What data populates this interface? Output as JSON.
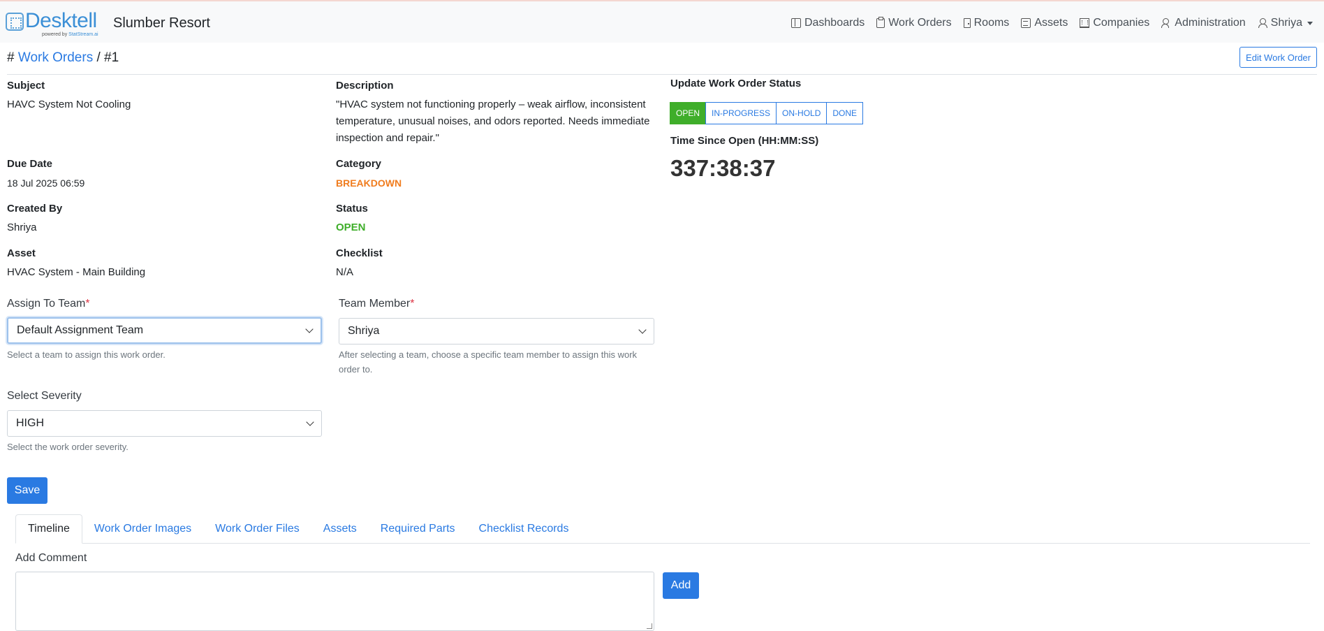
{
  "header": {
    "logo_text": "Desktell",
    "logo_sub_prefix": "powered by",
    "logo_sub_brand": "StatStream.ai",
    "org_name": "Slumber Resort"
  },
  "nav": {
    "items": [
      {
        "label": "Dashboards",
        "icon": "dashboard-icon"
      },
      {
        "label": "Work Orders",
        "icon": "clipboard-icon"
      },
      {
        "label": "Rooms",
        "icon": "door-icon"
      },
      {
        "label": "Assets",
        "icon": "asset-icon"
      },
      {
        "label": "Companies",
        "icon": "building-icon"
      },
      {
        "label": "Administration",
        "icon": "user-gear-icon"
      }
    ],
    "user": {
      "label": "Shriya",
      "icon": "user-icon"
    }
  },
  "breadcrumb": {
    "hash": "#",
    "link": "Work Orders",
    "sep": "/",
    "current": "#1"
  },
  "edit_button": "Edit Work Order",
  "details": {
    "subject": {
      "label": "Subject",
      "value": "HAVC System Not Cooling"
    },
    "description": {
      "label": "Description",
      "value": "\"HVAC system not functioning properly – weak airflow, inconsistent temperature, unusual noises, and odors reported. Needs immediate inspection and repair.\""
    },
    "due_date": {
      "label": "Due Date",
      "value": "18 Jul 2025 06:59"
    },
    "category": {
      "label": "Category",
      "value": "BREAKDOWN",
      "color": "#f07c1e"
    },
    "created_by": {
      "label": "Created By",
      "value": "Shriya"
    },
    "status": {
      "label": "Status",
      "value": "OPEN",
      "color": "#3fae2a"
    },
    "asset": {
      "label": "Asset",
      "value": "HVAC System - Main Building"
    },
    "checklist": {
      "label": "Checklist",
      "value": "N/A"
    }
  },
  "status_panel": {
    "title": "Update Work Order Status",
    "buttons": [
      "OPEN",
      "IN-PROGRESS",
      "ON-HOLD",
      "DONE"
    ],
    "active": "OPEN",
    "timer_label": "Time Since Open (HH:MM:SS)",
    "timer_value": "337:38:37"
  },
  "form": {
    "team": {
      "label": "Assign To Team",
      "required": "*",
      "value": "Default Assignment Team",
      "help": "Select a team to assign this work order."
    },
    "member": {
      "label": "Team Member",
      "required": "*",
      "value": "Shriya",
      "help": "After selecting a team, choose a specific team member to assign this work order to."
    },
    "severity": {
      "label": "Select Severity",
      "value": "HIGH",
      "help": "Select the work order severity."
    },
    "save_label": "Save"
  },
  "tabs": [
    "Timeline",
    "Work Order Images",
    "Work Order Files",
    "Assets",
    "Required Parts",
    "Checklist Records"
  ],
  "active_tab": "Timeline",
  "comment": {
    "label": "Add Comment",
    "value": "",
    "add_label": "Add"
  },
  "colors": {
    "accent": "#2a7ae2",
    "success": "#3fae2a",
    "warning": "#f07c1e"
  }
}
